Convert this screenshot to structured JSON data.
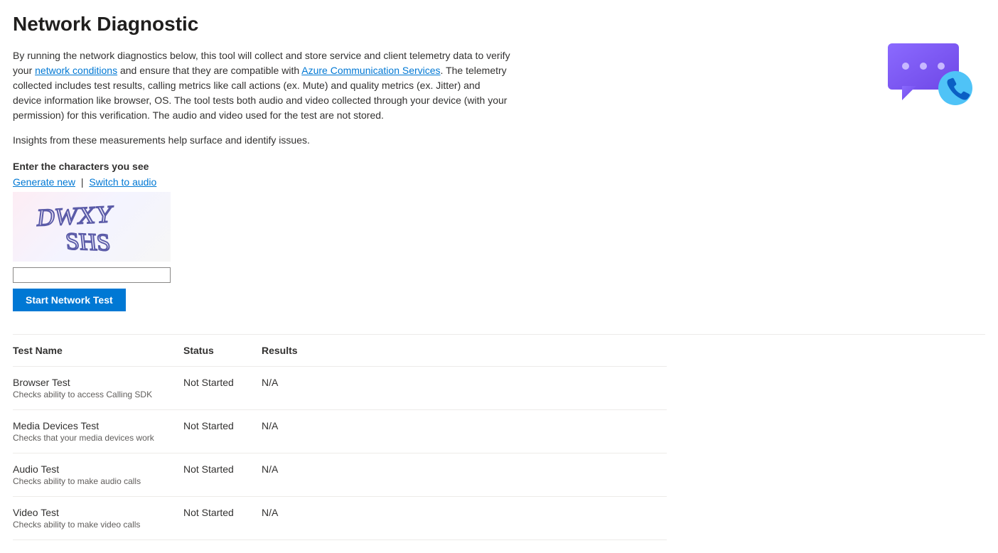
{
  "page": {
    "title": "Network Diagnostic",
    "intro_pre": "By running the network diagnostics below, this tool will collect and store service and client telemetry data to verify your ",
    "link_network": "network conditions",
    "intro_mid1": " and ensure that they are compatible with ",
    "link_acs": "Azure Communication Services",
    "intro_post": ". The telemetry collected includes test results, calling metrics like call actions (ex. Mute) and quality metrics (ex. Jitter) and device information like browser, OS. The tool tests both audio and video collected through your device (with your permission) for this verification. The audio and video used for the test are not stored.",
    "insights": "Insights from these measurements help surface and identify issues."
  },
  "captcha": {
    "label": "Enter the characters you see",
    "generate_new": "Generate new",
    "divider": "|",
    "switch_audio": "Switch to audio",
    "input_value": "",
    "start_btn": "Start Network Test",
    "image_text_line1": "DWXY",
    "image_text_line2": "SHS"
  },
  "table": {
    "headers": {
      "name": "Test Name",
      "status": "Status",
      "results": "Results"
    },
    "rows": [
      {
        "name": "Browser Test",
        "desc": "Checks ability to access Calling SDK",
        "status": "Not Started",
        "results": "N/A"
      },
      {
        "name": "Media Devices Test",
        "desc": "Checks that your media devices work",
        "status": "Not Started",
        "results": "N/A"
      },
      {
        "name": "Audio Test",
        "desc": "Checks ability to make audio calls",
        "status": "Not Started",
        "results": "N/A"
      },
      {
        "name": "Video Test",
        "desc": "Checks ability to make video calls",
        "status": "Not Started",
        "results": "N/A"
      }
    ]
  }
}
